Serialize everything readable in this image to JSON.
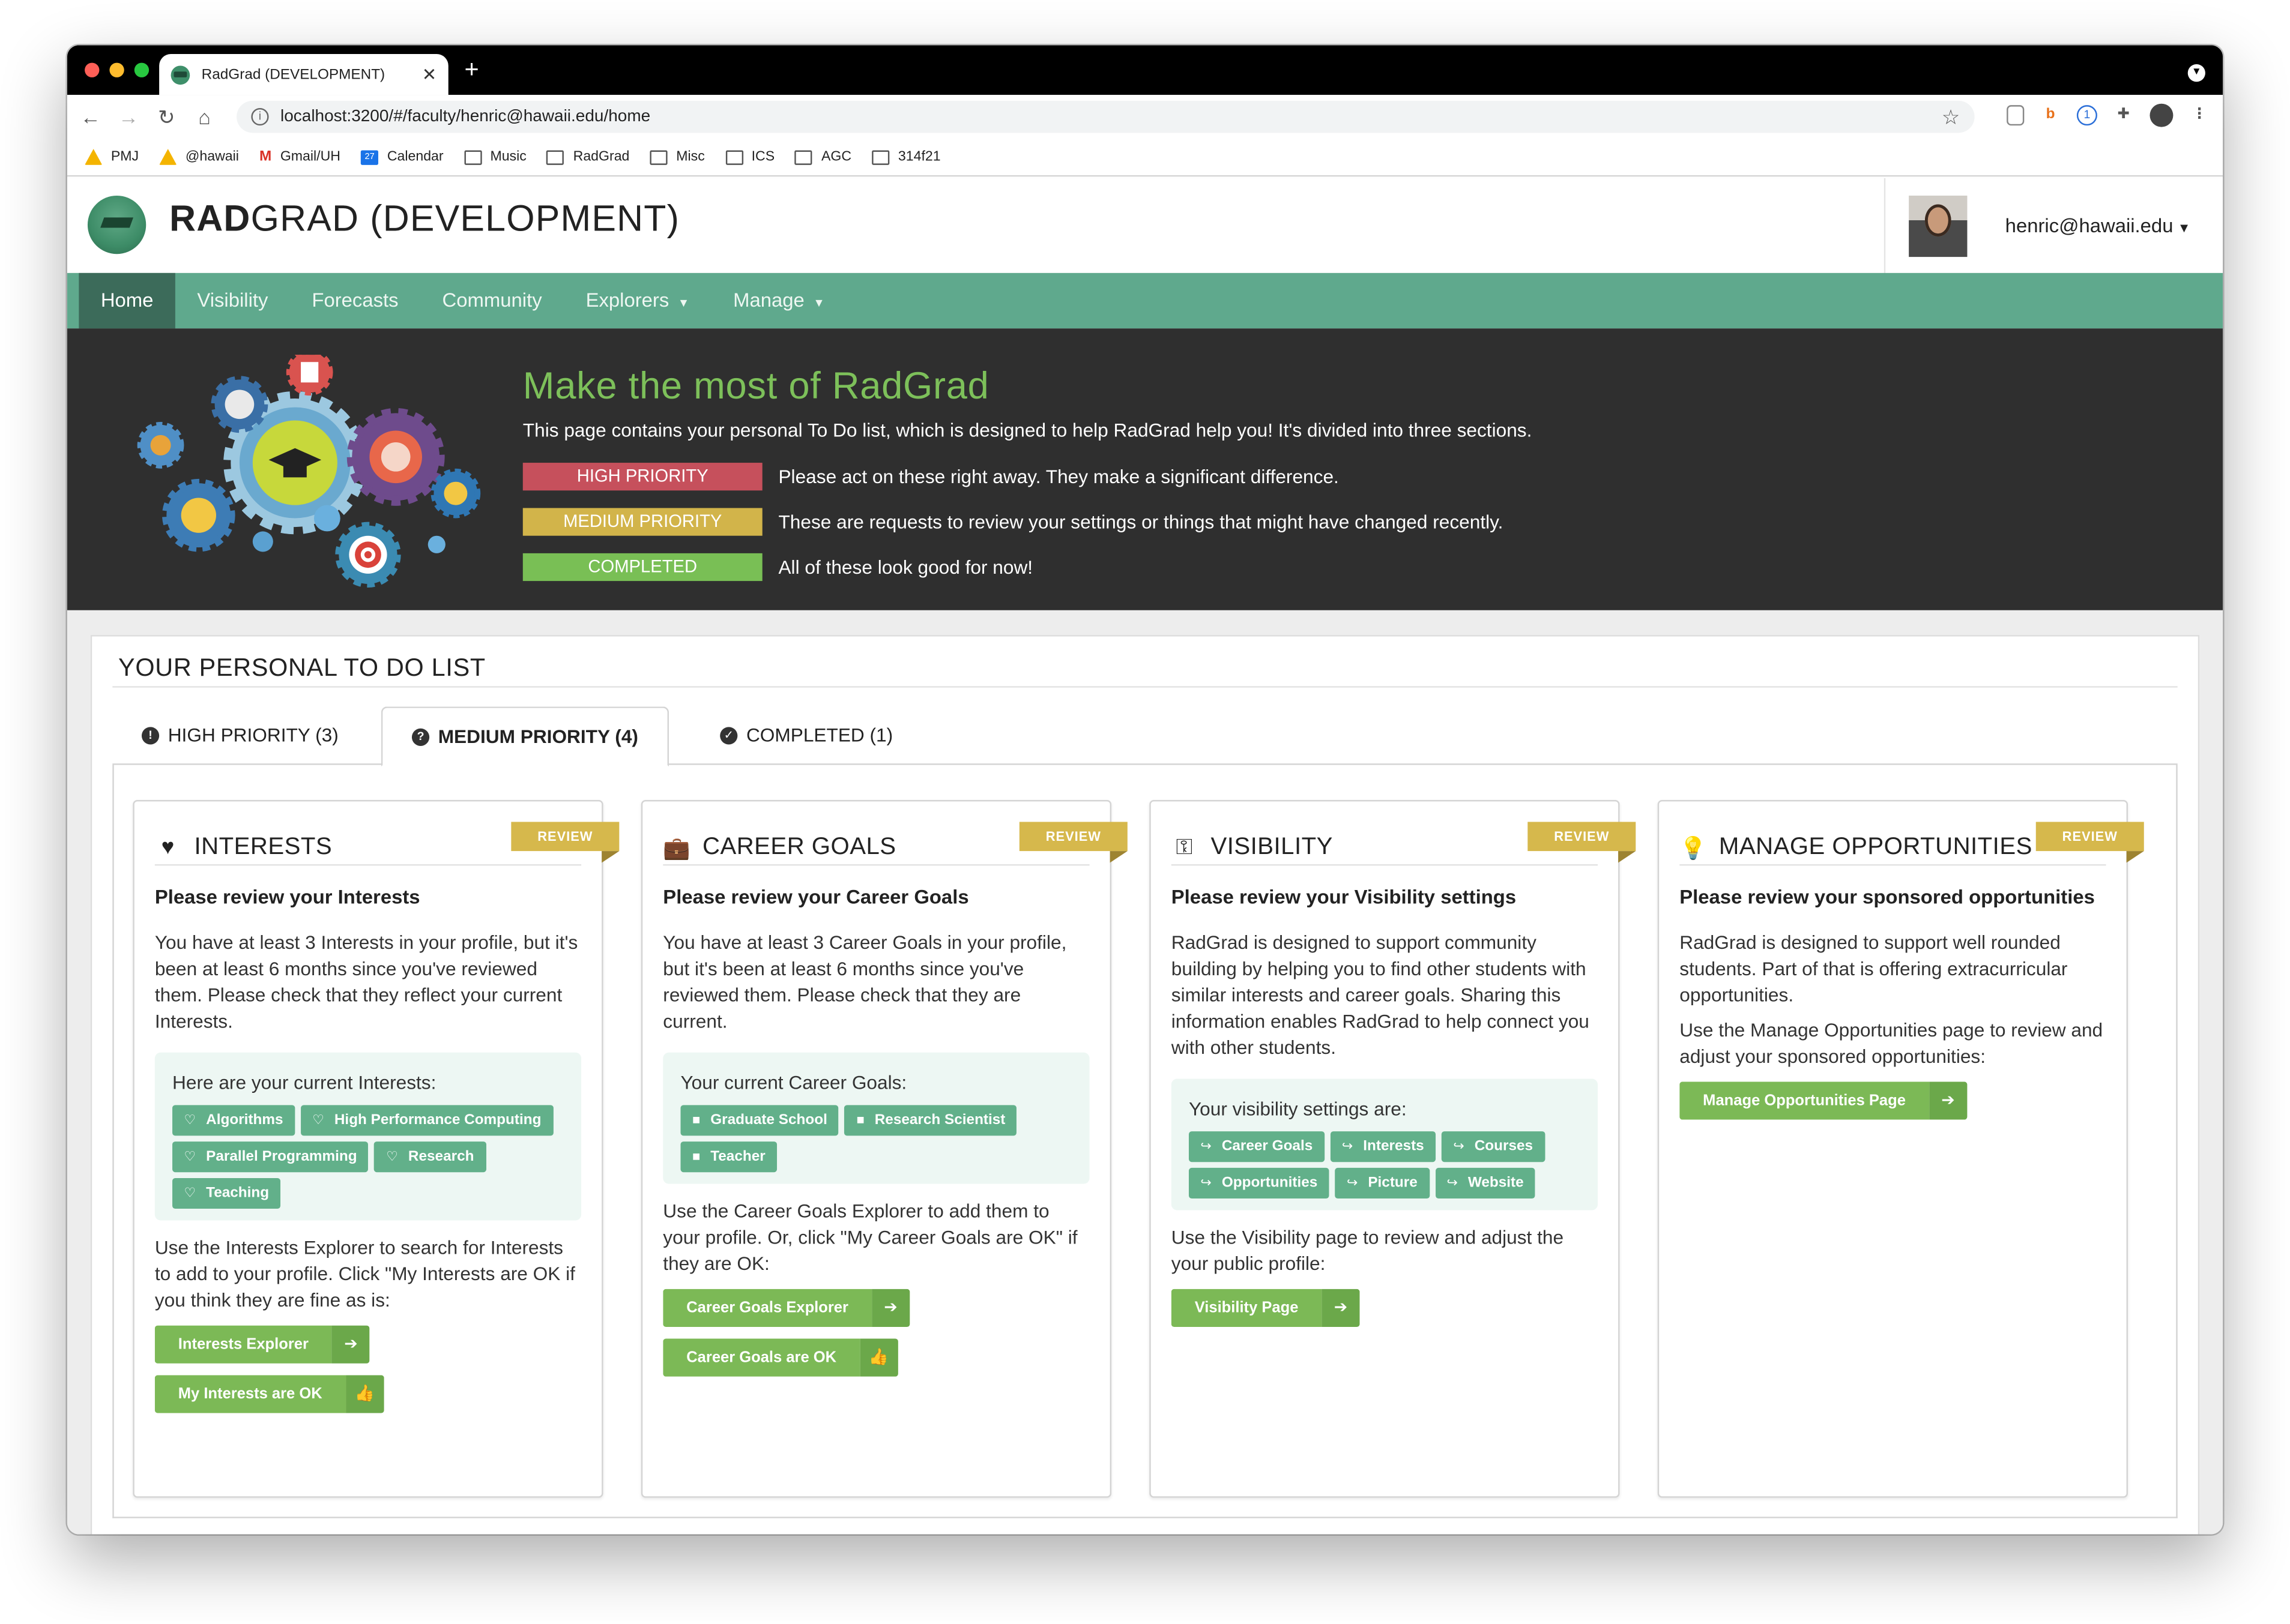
{
  "browser": {
    "tab_title": "RadGrad (DEVELOPMENT)",
    "url": "localhost:3200/#/faculty/henric@hawaii.edu/home",
    "bookmarks": [
      "PMJ",
      "@hawaii",
      "Gmail/UH",
      "Calendar",
      "Music",
      "RadGrad",
      "Misc",
      "ICS",
      "AGC",
      "314f21"
    ]
  },
  "header": {
    "brand_bold": "RADGRAD",
    "brand_rest": "GRAD (DEVELOPMENT)",
    "user": "henric@hawaii.edu"
  },
  "nav": {
    "items": [
      {
        "label": "Home",
        "active": true
      },
      {
        "label": "Visibility"
      },
      {
        "label": "Forecasts"
      },
      {
        "label": "Community"
      },
      {
        "label": "Explorers",
        "dropdown": true
      },
      {
        "label": "Manage",
        "dropdown": true
      }
    ]
  },
  "hero": {
    "title": "Make the most of RadGrad",
    "intro": "This page contains your personal To Do list, which is designed to help RadGrad help you! It's divided into three sections.",
    "priorities": [
      {
        "label": "HIGH PRIORITY",
        "desc": "Please act on these right away. They make a significant difference.",
        "color": "#c6505c"
      },
      {
        "label": "MEDIUM PRIORITY",
        "desc": "These are requests to review your settings or things that might have changed recently.",
        "color": "#d2b44a"
      },
      {
        "label": "COMPLETED",
        "desc": "All of these look good for now!",
        "color": "#79bf55"
      }
    ]
  },
  "todo": {
    "title": "YOUR PERSONAL TO DO LIST",
    "tabs": [
      {
        "label": "HIGH PRIORITY (3)",
        "icon": "exclamation-circle-icon"
      },
      {
        "label": "MEDIUM PRIORITY (4)",
        "icon": "question-circle-icon",
        "active": true
      },
      {
        "label": "COMPLETED (1)",
        "icon": "check-circle-icon"
      }
    ],
    "review_label": "REVIEW",
    "cards": {
      "interests": {
        "title": "INTERESTS",
        "subtitle": "Please review your Interests",
        "text": "You have at least 3 Interests in your profile, but it's been at least 6 months since you've reviewed them. Please check that they reflect your current Interests.",
        "box_title": "Here are your current Interests:",
        "chips": [
          "Algorithms",
          "High Performance Computing",
          "Parallel Programming",
          "Research",
          "Teaching"
        ],
        "text2": "Use the Interests Explorer to search for Interests to add to your profile. Click \"My Interests are OK if you think they are fine as is:",
        "btn1": "Interests Explorer",
        "btn2": "My Interests are OK"
      },
      "career": {
        "title": "CAREER GOALS",
        "subtitle": "Please review your Career Goals",
        "text": "You have at least 3 Career Goals in your profile, but it's been at least 6 months since you've reviewed them. Please check that they are current.",
        "box_title": "Your current Career Goals:",
        "chips": [
          "Graduate School",
          "Research Scientist",
          "Teacher"
        ],
        "text2": "Use the Career Goals Explorer to add them to your profile. Or, click \"My Career Goals are OK\" if they are OK:",
        "btn1": "Career Goals Explorer",
        "btn2": "Career Goals are OK"
      },
      "visibility": {
        "title": "VISIBILITY",
        "subtitle": "Please review your Visibility settings",
        "text": "RadGrad is designed to support community building by helping you to find other students with similar interests and career goals. Sharing this information enables RadGrad to help connect you with other students.",
        "box_title": "Your visibility settings are:",
        "chips": [
          "Career Goals",
          "Interests",
          "Courses",
          "Opportunities",
          "Picture",
          "Website"
        ],
        "text2": "Use the Visibility page to review and adjust the your public profile:",
        "btn1": "Visibility Page"
      },
      "opportunities": {
        "title": "MANAGE OPPORTUNITIES",
        "subtitle": "Please review your sponsored opportunities",
        "text": "RadGrad is designed to support well rounded students. Part of that is offering extracurricular opportunities.",
        "text2": "Use the Manage Opportunities page to review and adjust your sponsored opportunities:",
        "btn1": "Manage Opportunities Page"
      }
    }
  }
}
